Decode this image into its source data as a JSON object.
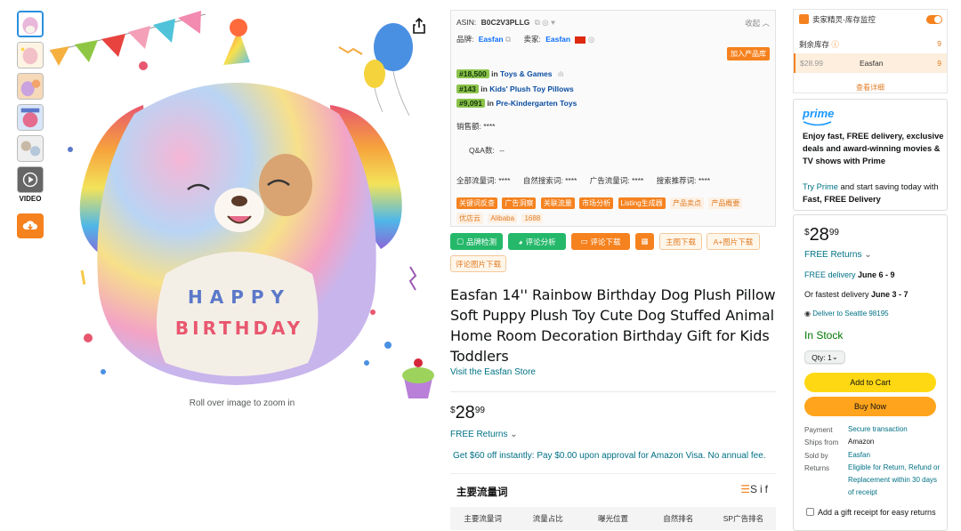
{
  "gallery": {
    "video_label": "VIDEO",
    "zoom_hint": "Roll over image to zoom in",
    "product_text_line1": "HAPPY",
    "product_text_line2": "BIRTHDAY"
  },
  "plugin": {
    "asin_label": "ASIN:",
    "asin": "B0C2V3PLLG",
    "collapse": "收起",
    "brand_label": "品牌:",
    "brand": "Easfan",
    "seller_label": "卖家:",
    "seller": "Easfan",
    "add_product": "加入产品库",
    "ranks": [
      {
        "rank": "#18,500",
        "in": "in",
        "category": "Toys & Games"
      },
      {
        "rank": "#143",
        "in": "in",
        "category": "Kids' Plush Toy Pillows"
      },
      {
        "rank": "#9,091",
        "in": "in",
        "category": "Pre-Kindergarten Toys"
      }
    ],
    "sales_label": "销售额:",
    "sales_value": "****",
    "qa_label": "Q&A数:",
    "qa_value": "--",
    "traffic": [
      {
        "label": "全部流量词:",
        "value": "****"
      },
      {
        "label": "自然搜索词:",
        "value": "****"
      },
      {
        "label": "广告流量词:",
        "value": "****"
      },
      {
        "label": "搜索推荐词:",
        "value": "****"
      }
    ],
    "chips_row1": [
      {
        "label": "关键词反查",
        "style": "solid"
      },
      {
        "label": "广告洞察",
        "style": "solid"
      },
      {
        "label": "关联流量",
        "style": "solid"
      },
      {
        "label": "市场分析",
        "style": "solid"
      },
      {
        "label": "Listing生成器",
        "style": "solid"
      },
      {
        "label": "产品卖点",
        "style": "outline"
      },
      {
        "label": "产品概要",
        "style": "outline"
      }
    ],
    "chips_row2": [
      {
        "label": "优店云",
        "style": "outline"
      },
      {
        "label": "Alibaba",
        "style": "outline"
      },
      {
        "label": "1688",
        "style": "outline"
      }
    ],
    "tools": {
      "brand_check": "品牌检测",
      "review_analysis": "评论分析",
      "review_download": "评论下载",
      "main_image_download": "主图下载",
      "aplus_download": "A+图片下载",
      "review_image_download": "评论图片下载"
    }
  },
  "product": {
    "title": "Easfan 14'' Rainbow Birthday Dog Plush Pillow Soft Puppy Plush Toy Cute Dog Stuffed Animal Home Room Decoration Birthday Gift for Kids Toddlers",
    "store_link": "Visit the Easfan Store",
    "price_symbol": "$",
    "price_whole": "28",
    "price_fraction": "99",
    "free_returns": "FREE Returns",
    "offer": "Get $60 off instantly: Pay $0.00 upon approval for Amazon Visa. No annual fee."
  },
  "keywords": {
    "title": "主要流量词",
    "brand": "Sif",
    "columns": [
      "主要流量词",
      "流量占比",
      "曝光位置",
      "自然排名",
      "SP广告排名"
    ]
  },
  "monitor": {
    "title": "卖家精灵-库存监控",
    "remaining_label": "剩余库存",
    "remaining_value": "9",
    "row_price": "$28.99",
    "row_seller": "Easfan",
    "row_qty": "9",
    "details": "查看详细"
  },
  "prime": {
    "logo": "prime",
    "pitch": "Enjoy fast, FREE delivery, exclusive deals and award-winning movies & TV shows with Prime",
    "try_link": "Try Prime",
    "try_text": " and start saving today with ",
    "try_bold": "Fast, FREE Delivery"
  },
  "buybox": {
    "price_symbol": "$",
    "price_whole": "28",
    "price_fraction": "99",
    "free_returns": "FREE Returns",
    "delivery_prefix": "FREE delivery",
    "delivery_date": "June 6 - 9",
    "fastest_prefix": "Or fastest delivery",
    "fastest_date": "June 3 - 7",
    "deliver_to": "Deliver to Seattle 98195",
    "stock": "In Stock",
    "qty": "Qty: 1",
    "add_to_cart": "Add to Cart",
    "buy_now": "Buy Now",
    "payment_label": "Payment",
    "payment_value": "Secure transaction",
    "ships_label": "Ships from",
    "ships_value": "Amazon",
    "sold_label": "Sold by",
    "sold_value": "Easfan",
    "returns_label": "Returns",
    "returns_value": "Eligible for Return, Refund or Replacement within 30 days of receipt",
    "gift_receipt": "Add a gift receipt for easy returns"
  },
  "colors": {
    "accent_orange": "#f5821f",
    "link": "#007185",
    "stock_green": "#007600",
    "cart_yellow": "#ffd814",
    "buy_orange": "#ffa41c"
  }
}
